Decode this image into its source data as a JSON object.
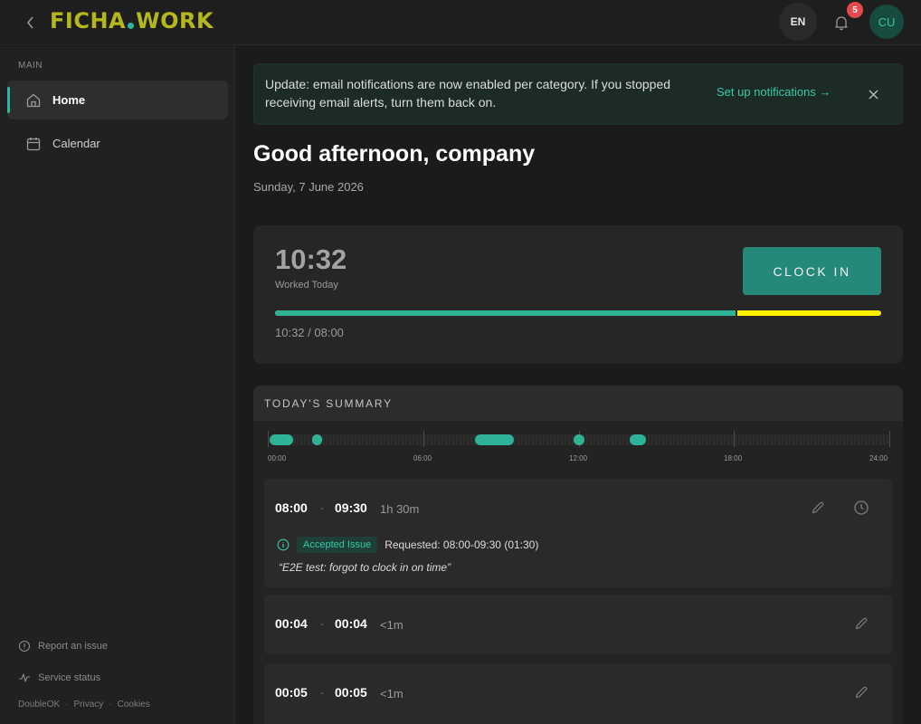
{
  "app": {
    "brand_left": "FICHA",
    "brand_right": "WORK",
    "brand_color": "#b4b81a",
    "accent_color": "#2bb89b"
  },
  "topbar": {
    "language": "EN",
    "notification_count": "5",
    "avatar_initials": "CU"
  },
  "sidebar": {
    "section_label": "MAIN",
    "items": [
      {
        "label": "Home",
        "icon": "home-icon",
        "active": true
      },
      {
        "label": "Calendar",
        "icon": "calendar-icon",
        "active": false
      }
    ],
    "footer": {
      "report_issue": "Report an issue",
      "service_status": "Service status",
      "legal": [
        "DoubleOK",
        "Privacy",
        "Cookies"
      ]
    }
  },
  "banner": {
    "text": "Update: email notifications are now enabled per category. If you stopped receiving email alerts, turn them back on.",
    "link": "Set up notifications →"
  },
  "greeting": "Good afternoon, company",
  "date": "Sunday, 7 June 2026",
  "clock": {
    "worked_time": "10:32",
    "worked_label": "Worked Today",
    "button_label": "CLOCK IN",
    "progress_text": "10:32 / 08:00",
    "target_fraction": 0.76,
    "fill_color": "#2fb295",
    "overtime_color": "#ffee00"
  },
  "summary": {
    "title": "TODAY'S SUMMARY",
    "timeline_labels": [
      "00:00",
      "06:00",
      "12:00",
      "18:00",
      "24:00"
    ],
    "entries": [
      {
        "start": "08:00",
        "end": "09:30",
        "duration": "1h 30m",
        "sep": "-",
        "status": "Accepted Issue",
        "requested": "Requested: 08:00-09:30 (01:30)",
        "note": "“E2E test: forgot to clock in on time”"
      },
      {
        "start": "00:04",
        "end": "00:04",
        "duration": "<1m",
        "sep": "-"
      },
      {
        "start": "00:05",
        "end": "00:05",
        "duration": "<1m",
        "sep": "-"
      }
    ]
  }
}
